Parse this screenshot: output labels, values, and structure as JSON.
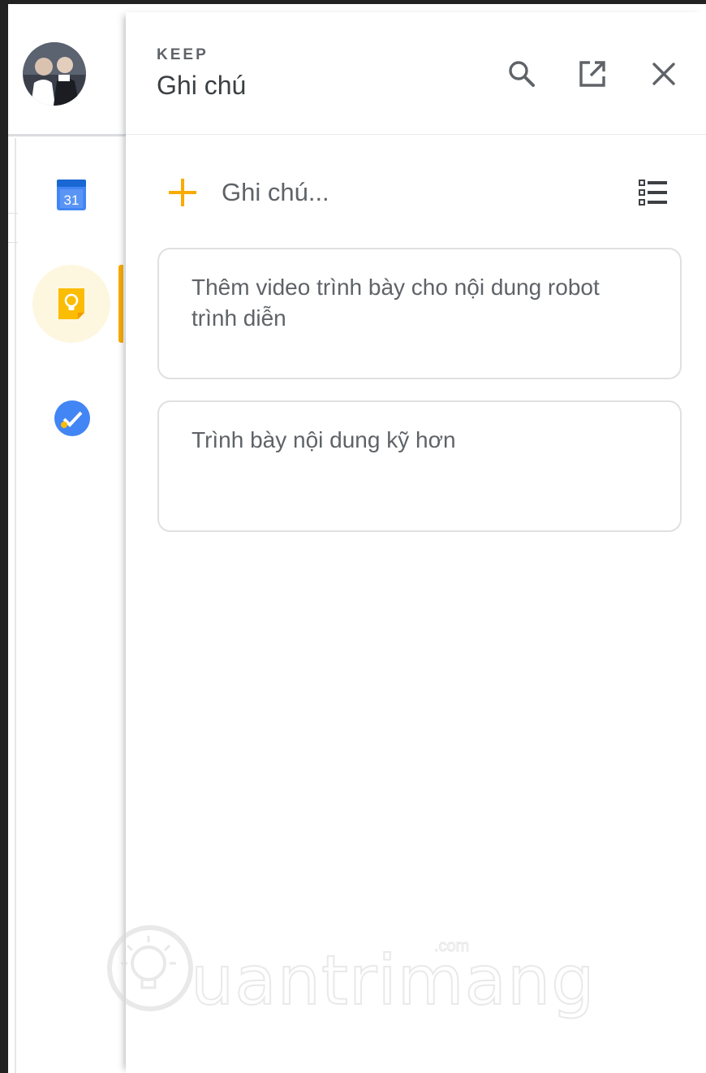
{
  "panel": {
    "app_label": "KEEP",
    "title": "Ghi chú"
  },
  "header_actions": {
    "search_icon": "search-icon",
    "open_icon": "open-in-new-icon",
    "close_icon": "close-icon"
  },
  "add_note": {
    "placeholder": "Ghi chú..."
  },
  "notes": [
    {
      "text": "Thêm video trình bày cho nội dung robot trình diễn"
    },
    {
      "text": "Trình bày nội dung kỹ hơn"
    }
  ],
  "side_rail": {
    "calendar_day": "31",
    "active_app": "keep"
  },
  "watermark": {
    "text": "uantrimang",
    "domain": ".com"
  },
  "colors": {
    "keep_yellow": "#f9ab00",
    "keep_highlight": "#fef7e0",
    "calendar_blue": "#4285f4",
    "tasks_blue": "#4285f4",
    "text_gray": "#5f6368"
  }
}
